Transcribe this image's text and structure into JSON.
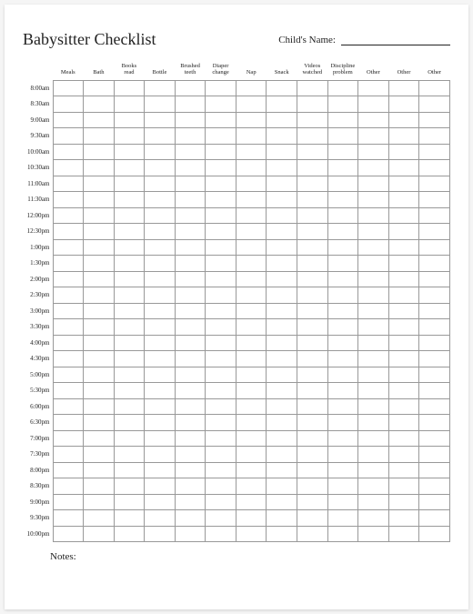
{
  "header": {
    "title": "Babysitter Checklist",
    "childname_label": "Child's Name:"
  },
  "columns": [
    "Meals",
    "Bath",
    "Books\nread",
    "Bottle",
    "Brushed\nteeth",
    "Diaper\nchange",
    "Nap",
    "Snack",
    "Videos\nwatched",
    "Discipline\nproblem",
    "Other",
    "Other",
    "Other"
  ],
  "times": [
    "8:00am",
    "8:30am",
    "9:00am",
    "9:30am",
    "10:00am",
    "10:30am",
    "11:00am",
    "11:30am",
    "12:00pm",
    "12:30pm",
    "1:00pm",
    "1:30pm",
    "2:00pm",
    "2:30pm",
    "3:00pm",
    "3:30pm",
    "4:00pm",
    "4:30pm",
    "5:00pm",
    "5:30pm",
    "6:00pm",
    "6:30pm",
    "7:00pm",
    "7:30pm",
    "8:00pm",
    "8:30pm",
    "9:00pm",
    "9:30pm",
    "10:00pm"
  ],
  "notes": {
    "label": "Notes:"
  }
}
